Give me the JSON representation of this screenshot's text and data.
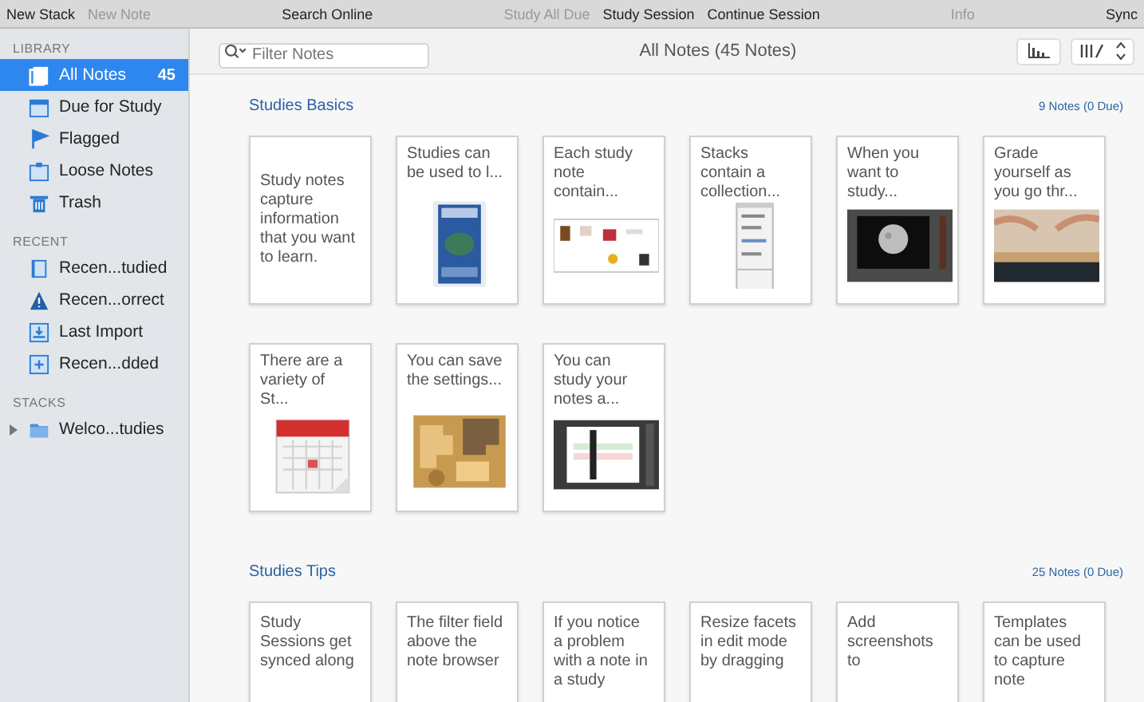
{
  "toolbar": {
    "groups": [
      [
        {
          "label": "New Stack",
          "disabled": false
        },
        {
          "label": "New Note",
          "disabled": true
        }
      ],
      [
        {
          "label": "Search Online",
          "disabled": false
        }
      ],
      [
        {
          "label": "Study All Due",
          "disabled": true
        },
        {
          "label": "Study Session",
          "disabled": false
        },
        {
          "label": "Continue Session",
          "disabled": false
        }
      ],
      [
        {
          "label": "Info",
          "disabled": true
        }
      ],
      [
        {
          "label": "Sync",
          "disabled": false
        }
      ]
    ]
  },
  "sidebar": {
    "sections": [
      {
        "heading": "LIBRARY",
        "items": [
          {
            "label": "All Notes",
            "count": "45",
            "selected": true
          },
          {
            "label": "Due for Study",
            "selected": false
          },
          {
            "label": "Flagged",
            "selected": false
          },
          {
            "label": "Loose Notes",
            "selected": false
          },
          {
            "label": "Trash",
            "selected": false
          }
        ]
      },
      {
        "heading": "RECENT",
        "items": [
          {
            "label": "Recen...tudied",
            "selected": false
          },
          {
            "label": "Recen...orrect",
            "selected": false
          },
          {
            "label": "Last Import",
            "selected": false
          },
          {
            "label": "Recen...dded",
            "selected": false
          }
        ]
      },
      {
        "heading": "STACKS",
        "items": [
          {
            "label": "Welco...tudies",
            "selected": false,
            "expanded": false
          }
        ]
      }
    ]
  },
  "header": {
    "filter": {
      "placeholder": "Filter Notes"
    },
    "title": "All Notes (45 Notes)"
  },
  "groups": [
    {
      "title": "Studies Basics",
      "summary": "9 Notes (0 Due)",
      "cards": [
        {
          "kind": "text",
          "text": "Study notes capture information that you want to learn."
        },
        {
          "kind": "picture",
          "text": "Studies can be used to l..."
        },
        {
          "kind": "picture",
          "text": "Each study note contain..."
        },
        {
          "kind": "picture",
          "text": "Stacks contain a collection..."
        },
        {
          "kind": "picture",
          "text": "When you want to study..."
        },
        {
          "kind": "picture",
          "text": "Grade yourself as you go thr..."
        },
        {
          "kind": "picture",
          "text": "There are a variety of St..."
        },
        {
          "kind": "picture",
          "text": "You can save the settings..."
        },
        {
          "kind": "picture",
          "text": "You can study your notes a..."
        }
      ]
    },
    {
      "title": "Studies Tips",
      "summary": "25 Notes (0 Due)",
      "cards": [
        {
          "kind": "text",
          "text": "Study Sessions get synced along"
        },
        {
          "kind": "text",
          "text": "The filter field above the note browser"
        },
        {
          "kind": "text",
          "text": "If you notice a problem with a note in a study"
        },
        {
          "kind": "text",
          "text": "Resize facets in edit mode by dragging"
        },
        {
          "kind": "text",
          "text": "Add screenshots to"
        },
        {
          "kind": "text",
          "text": "Templates can be used to capture note"
        }
      ]
    }
  ]
}
